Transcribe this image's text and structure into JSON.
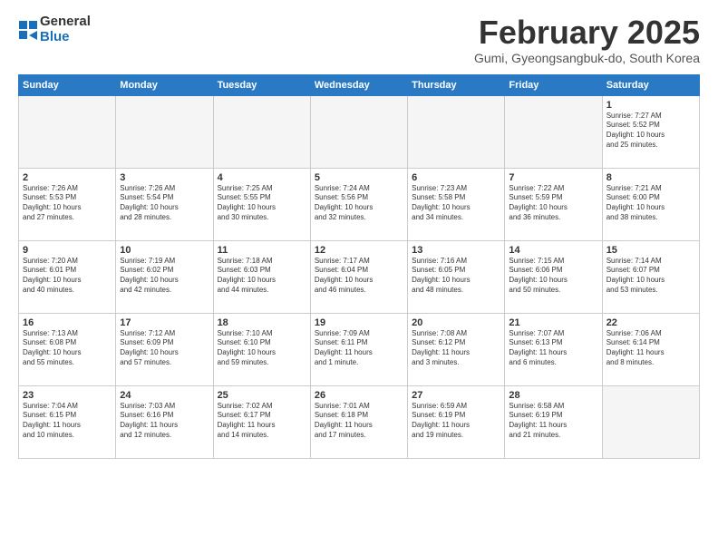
{
  "header": {
    "logo_general": "General",
    "logo_blue": "Blue",
    "month_title": "February 2025",
    "subtitle": "Gumi, Gyeongsangbuk-do, South Korea"
  },
  "days_of_week": [
    "Sunday",
    "Monday",
    "Tuesday",
    "Wednesday",
    "Thursday",
    "Friday",
    "Saturday"
  ],
  "weeks": [
    [
      {
        "day": "",
        "info": ""
      },
      {
        "day": "",
        "info": ""
      },
      {
        "day": "",
        "info": ""
      },
      {
        "day": "",
        "info": ""
      },
      {
        "day": "",
        "info": ""
      },
      {
        "day": "",
        "info": ""
      },
      {
        "day": "1",
        "info": "Sunrise: 7:27 AM\nSunset: 5:52 PM\nDaylight: 10 hours\nand 25 minutes."
      }
    ],
    [
      {
        "day": "2",
        "info": "Sunrise: 7:26 AM\nSunset: 5:53 PM\nDaylight: 10 hours\nand 27 minutes."
      },
      {
        "day": "3",
        "info": "Sunrise: 7:26 AM\nSunset: 5:54 PM\nDaylight: 10 hours\nand 28 minutes."
      },
      {
        "day": "4",
        "info": "Sunrise: 7:25 AM\nSunset: 5:55 PM\nDaylight: 10 hours\nand 30 minutes."
      },
      {
        "day": "5",
        "info": "Sunrise: 7:24 AM\nSunset: 5:56 PM\nDaylight: 10 hours\nand 32 minutes."
      },
      {
        "day": "6",
        "info": "Sunrise: 7:23 AM\nSunset: 5:58 PM\nDaylight: 10 hours\nand 34 minutes."
      },
      {
        "day": "7",
        "info": "Sunrise: 7:22 AM\nSunset: 5:59 PM\nDaylight: 10 hours\nand 36 minutes."
      },
      {
        "day": "8",
        "info": "Sunrise: 7:21 AM\nSunset: 6:00 PM\nDaylight: 10 hours\nand 38 minutes."
      }
    ],
    [
      {
        "day": "9",
        "info": "Sunrise: 7:20 AM\nSunset: 6:01 PM\nDaylight: 10 hours\nand 40 minutes."
      },
      {
        "day": "10",
        "info": "Sunrise: 7:19 AM\nSunset: 6:02 PM\nDaylight: 10 hours\nand 42 minutes."
      },
      {
        "day": "11",
        "info": "Sunrise: 7:18 AM\nSunset: 6:03 PM\nDaylight: 10 hours\nand 44 minutes."
      },
      {
        "day": "12",
        "info": "Sunrise: 7:17 AM\nSunset: 6:04 PM\nDaylight: 10 hours\nand 46 minutes."
      },
      {
        "day": "13",
        "info": "Sunrise: 7:16 AM\nSunset: 6:05 PM\nDaylight: 10 hours\nand 48 minutes."
      },
      {
        "day": "14",
        "info": "Sunrise: 7:15 AM\nSunset: 6:06 PM\nDaylight: 10 hours\nand 50 minutes."
      },
      {
        "day": "15",
        "info": "Sunrise: 7:14 AM\nSunset: 6:07 PM\nDaylight: 10 hours\nand 53 minutes."
      }
    ],
    [
      {
        "day": "16",
        "info": "Sunrise: 7:13 AM\nSunset: 6:08 PM\nDaylight: 10 hours\nand 55 minutes."
      },
      {
        "day": "17",
        "info": "Sunrise: 7:12 AM\nSunset: 6:09 PM\nDaylight: 10 hours\nand 57 minutes."
      },
      {
        "day": "18",
        "info": "Sunrise: 7:10 AM\nSunset: 6:10 PM\nDaylight: 10 hours\nand 59 minutes."
      },
      {
        "day": "19",
        "info": "Sunrise: 7:09 AM\nSunset: 6:11 PM\nDaylight: 11 hours\nand 1 minute."
      },
      {
        "day": "20",
        "info": "Sunrise: 7:08 AM\nSunset: 6:12 PM\nDaylight: 11 hours\nand 3 minutes."
      },
      {
        "day": "21",
        "info": "Sunrise: 7:07 AM\nSunset: 6:13 PM\nDaylight: 11 hours\nand 6 minutes."
      },
      {
        "day": "22",
        "info": "Sunrise: 7:06 AM\nSunset: 6:14 PM\nDaylight: 11 hours\nand 8 minutes."
      }
    ],
    [
      {
        "day": "23",
        "info": "Sunrise: 7:04 AM\nSunset: 6:15 PM\nDaylight: 11 hours\nand 10 minutes."
      },
      {
        "day": "24",
        "info": "Sunrise: 7:03 AM\nSunset: 6:16 PM\nDaylight: 11 hours\nand 12 minutes."
      },
      {
        "day": "25",
        "info": "Sunrise: 7:02 AM\nSunset: 6:17 PM\nDaylight: 11 hours\nand 14 minutes."
      },
      {
        "day": "26",
        "info": "Sunrise: 7:01 AM\nSunset: 6:18 PM\nDaylight: 11 hours\nand 17 minutes."
      },
      {
        "day": "27",
        "info": "Sunrise: 6:59 AM\nSunset: 6:19 PM\nDaylight: 11 hours\nand 19 minutes."
      },
      {
        "day": "28",
        "info": "Sunrise: 6:58 AM\nSunset: 6:19 PM\nDaylight: 11 hours\nand 21 minutes."
      },
      {
        "day": "",
        "info": ""
      }
    ]
  ]
}
